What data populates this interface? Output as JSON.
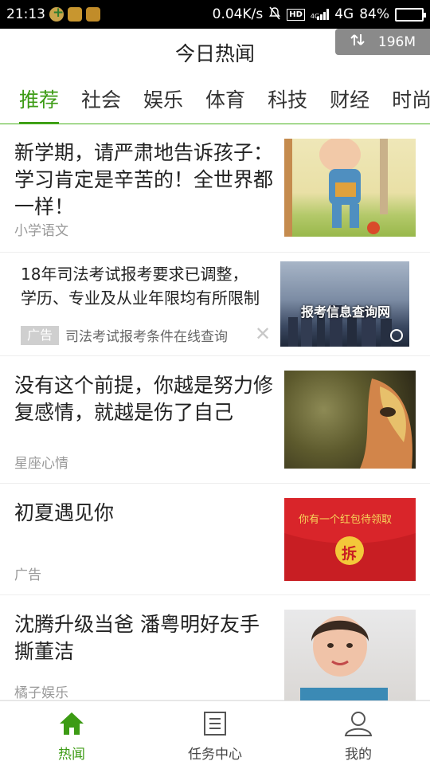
{
  "status_bar": {
    "time": "21:13",
    "network_speed": "0.04K/s",
    "hd_badge": "HD",
    "signal_type": "4G",
    "battery": "84%",
    "battery_level": 0.84
  },
  "header": {
    "title": "今日热闻",
    "memory": "196M"
  },
  "tabs": [
    {
      "label": "推荐",
      "active": true
    },
    {
      "label": "社会",
      "active": false
    },
    {
      "label": "娱乐",
      "active": false
    },
    {
      "label": "体育",
      "active": false
    },
    {
      "label": "科技",
      "active": false
    },
    {
      "label": "财经",
      "active": false
    },
    {
      "label": "时尚",
      "active": false
    }
  ],
  "feed": {
    "items": [
      {
        "headline": "新学期，请严肃地告诉孩子：学习肯定是辛苦的！全世界都一样！",
        "source": "小学语文"
      },
      {
        "headline": "18年司法考试报考要求已调整，学历、专业及从业年限均有所限制",
        "ad_tag": "广告",
        "ad_desc": "司法考试报考条件在线查询",
        "thumb_text": "报考信息查询网"
      },
      {
        "headline": "没有这个前提，你越是努力修复感情，就越是伤了自己",
        "source": "星座心情"
      },
      {
        "headline": "初夏遇见你",
        "source": "广告",
        "thumb_text": "你有一个红包待领取",
        "thumb_button": "拆"
      },
      {
        "headline": "沈腾升级当爸 潘粤明好友手撕董洁",
        "source": "橘子娱乐"
      }
    ]
  },
  "bottom_nav": [
    {
      "label": "热闻",
      "icon": "home-icon",
      "active": true
    },
    {
      "label": "任务中心",
      "icon": "task-list-icon",
      "active": false
    },
    {
      "label": "我的",
      "icon": "user-icon",
      "active": false
    }
  ],
  "colors": {
    "accent": "#3c9b14",
    "status_bar_bg": "#000000",
    "battery_fill": "#3ccb3c",
    "memory_badge_bg": "#8a8a8a"
  }
}
